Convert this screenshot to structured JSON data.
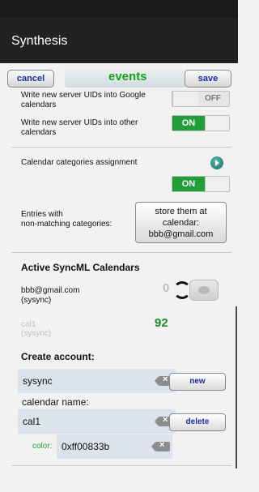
{
  "app": {
    "title": "Synthesis"
  },
  "toolbar": {
    "cancel_label": "cancel",
    "title": "events",
    "save_label": "save"
  },
  "settings": {
    "google_uids_label": "Write new server UIDs into Google calendars",
    "google_uids_state": "OFF",
    "other_uids_label": "Write new server UIDs into other calendars",
    "other_uids_state": "ON",
    "categories_label": "Calendar categories assignment",
    "categories_state": "ON",
    "entries_label_1": "Entries with",
    "entries_label_2": "non-matching categories:",
    "store_line1": "store them at",
    "store_line2": "calendar:",
    "store_line3": "bbb@gmail.com"
  },
  "active": {
    "title": "Active SyncML Calendars",
    "calendars": [
      {
        "name": "bbb@gmail.com",
        "account": "(sysync)",
        "count": "0"
      },
      {
        "name": "cal1",
        "account": "(sysync)",
        "count": "92"
      }
    ]
  },
  "create": {
    "title": "Create account:",
    "account_value": "sysync",
    "new_label": "new",
    "calendar_name_label": "calendar name:",
    "calendar_value": "cal1",
    "delete_label": "delete",
    "color_label": "color:",
    "color_value": "0xff00833b"
  },
  "colors": {
    "accent_green": "#1f9e3a",
    "count_green": "#1a8a2a",
    "button_text": "#1b2fa0"
  },
  "icons": [
    "next-arrow-icon",
    "sync-icon",
    "eye-icon",
    "clear-text-icon"
  ]
}
